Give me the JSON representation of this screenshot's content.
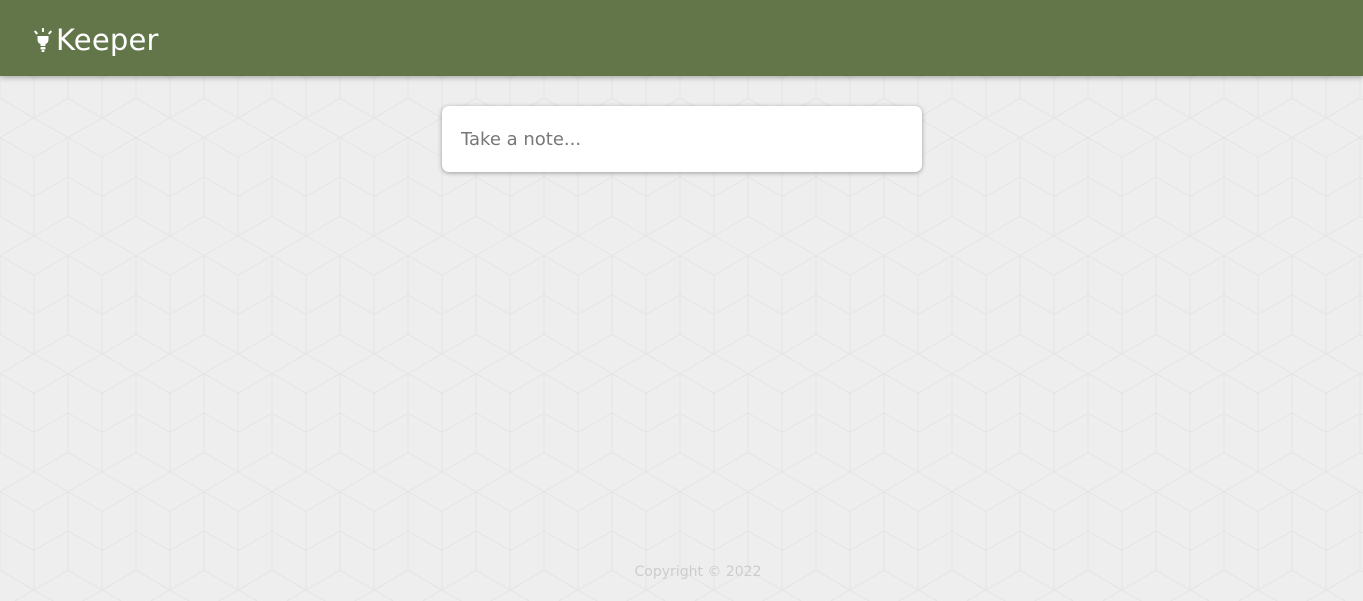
{
  "header": {
    "title": "Keeper",
    "icon": "lightbulb-icon",
    "background_color": "#627649"
  },
  "note_form": {
    "placeholder": "Take a note..."
  },
  "footer": {
    "copyright": "Copyright © 2022"
  }
}
